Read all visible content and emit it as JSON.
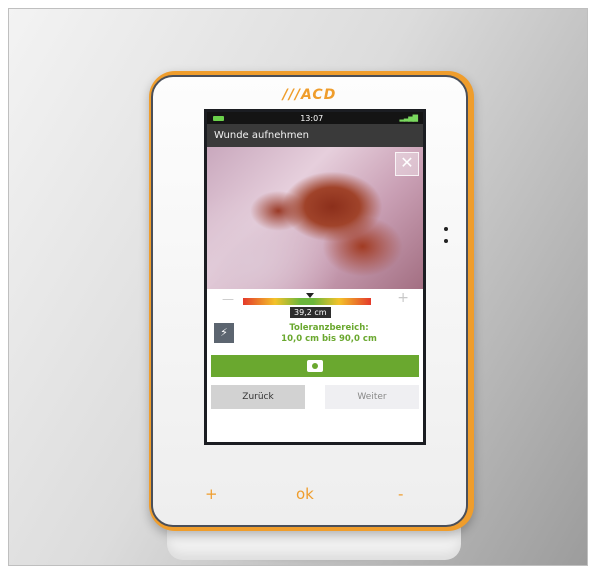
{
  "device": {
    "brand_logo": "///ACD",
    "hw_buttons": {
      "plus": "+",
      "ok": "ok",
      "minus": "-"
    },
    "accent_color": "#ef9d2c"
  },
  "status_bar": {
    "time": "13:07",
    "battery_icon": "battery-icon",
    "signal_icon": "signal-icon"
  },
  "screen": {
    "title": "Wunde aufnehmen",
    "close_icon": "close-icon",
    "slider": {
      "minus_label": "—",
      "plus_label": "+",
      "value": "39,2 cm",
      "level": 0.52
    },
    "flash_icon": "flash-off-icon",
    "tolerance": {
      "heading": "Toleranzbereich:",
      "range": "10,0 cm bis 90,0 cm"
    },
    "camera_icon": "camera-icon",
    "buttons": {
      "back": "Zurück",
      "next": "Weiter"
    },
    "colors": {
      "primary_green": "#6aa82f",
      "title_bar": "#3a3a3a"
    }
  }
}
